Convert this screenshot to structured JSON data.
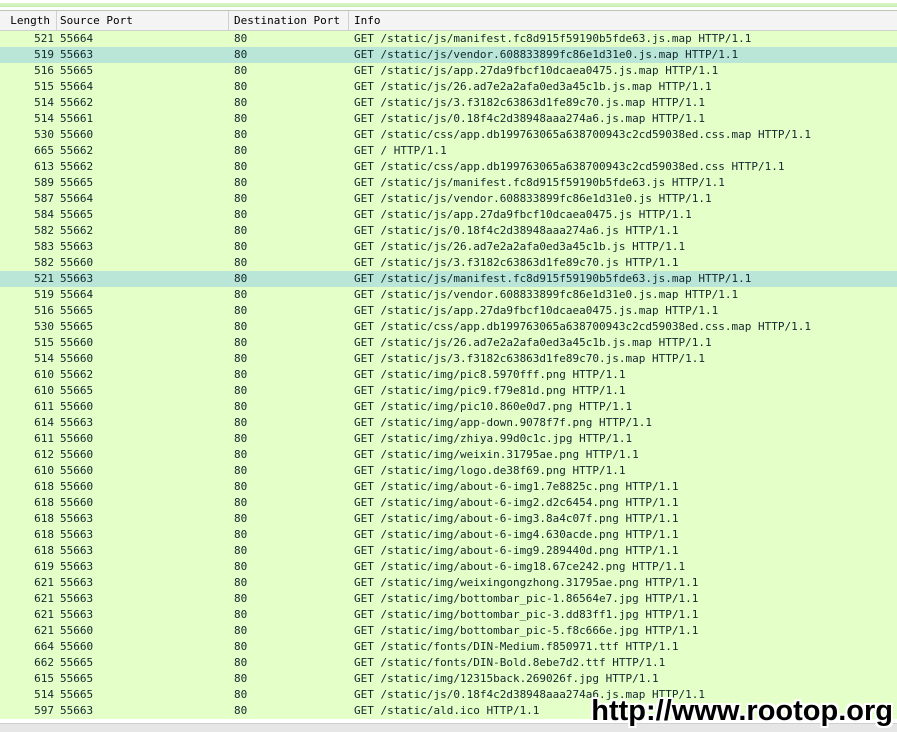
{
  "columns": {
    "length": "Length",
    "source_port": "Source Port",
    "destination_port": "Destination Port",
    "info": "Info"
  },
  "selected_rows": [
    1,
    15
  ],
  "rows": [
    {
      "length": "521",
      "src": "55664",
      "dst": "80",
      "info": "GET /static/js/manifest.fc8d915f59190b5fde63.js.map HTTP/1.1"
    },
    {
      "length": "519",
      "src": "55663",
      "dst": "80",
      "info": "GET /static/js/vendor.608833899fc86e1d31e0.js.map HTTP/1.1"
    },
    {
      "length": "516",
      "src": "55665",
      "dst": "80",
      "info": "GET /static/js/app.27da9fbcf10dcaea0475.js.map HTTP/1.1"
    },
    {
      "length": "515",
      "src": "55664",
      "dst": "80",
      "info": "GET /static/js/26.ad7e2a2afa0ed3a45c1b.js.map HTTP/1.1"
    },
    {
      "length": "514",
      "src": "55662",
      "dst": "80",
      "info": "GET /static/js/3.f3182c63863d1fe89c70.js.map HTTP/1.1"
    },
    {
      "length": "514",
      "src": "55661",
      "dst": "80",
      "info": "GET /static/js/0.18f4c2d38948aaa274a6.js.map HTTP/1.1"
    },
    {
      "length": "530",
      "src": "55660",
      "dst": "80",
      "info": "GET /static/css/app.db199763065a638700943c2cd59038ed.css.map HTTP/1.1"
    },
    {
      "length": "665",
      "src": "55662",
      "dst": "80",
      "info": "GET / HTTP/1.1"
    },
    {
      "length": "613",
      "src": "55662",
      "dst": "80",
      "info": "GET /static/css/app.db199763065a638700943c2cd59038ed.css HTTP/1.1"
    },
    {
      "length": "589",
      "src": "55665",
      "dst": "80",
      "info": "GET /static/js/manifest.fc8d915f59190b5fde63.js HTTP/1.1"
    },
    {
      "length": "587",
      "src": "55664",
      "dst": "80",
      "info": "GET /static/js/vendor.608833899fc86e1d31e0.js HTTP/1.1"
    },
    {
      "length": "584",
      "src": "55665",
      "dst": "80",
      "info": "GET /static/js/app.27da9fbcf10dcaea0475.js HTTP/1.1"
    },
    {
      "length": "582",
      "src": "55662",
      "dst": "80",
      "info": "GET /static/js/0.18f4c2d38948aaa274a6.js HTTP/1.1"
    },
    {
      "length": "583",
      "src": "55663",
      "dst": "80",
      "info": "GET /static/js/26.ad7e2a2afa0ed3a45c1b.js HTTP/1.1"
    },
    {
      "length": "582",
      "src": "55660",
      "dst": "80",
      "info": "GET /static/js/3.f3182c63863d1fe89c70.js HTTP/1.1"
    },
    {
      "length": "521",
      "src": "55663",
      "dst": "80",
      "info": "GET /static/js/manifest.fc8d915f59190b5fde63.js.map HTTP/1.1"
    },
    {
      "length": "519",
      "src": "55664",
      "dst": "80",
      "info": "GET /static/js/vendor.608833899fc86e1d31e0.js.map HTTP/1.1"
    },
    {
      "length": "516",
      "src": "55665",
      "dst": "80",
      "info": "GET /static/js/app.27da9fbcf10dcaea0475.js.map HTTP/1.1"
    },
    {
      "length": "530",
      "src": "55665",
      "dst": "80",
      "info": "GET /static/css/app.db199763065a638700943c2cd59038ed.css.map HTTP/1.1"
    },
    {
      "length": "515",
      "src": "55660",
      "dst": "80",
      "info": "GET /static/js/26.ad7e2a2afa0ed3a45c1b.js.map HTTP/1.1"
    },
    {
      "length": "514",
      "src": "55660",
      "dst": "80",
      "info": "GET /static/js/3.f3182c63863d1fe89c70.js.map HTTP/1.1"
    },
    {
      "length": "610",
      "src": "55662",
      "dst": "80",
      "info": "GET /static/img/pic8.5970fff.png HTTP/1.1"
    },
    {
      "length": "610",
      "src": "55665",
      "dst": "80",
      "info": "GET /static/img/pic9.f79e81d.png HTTP/1.1"
    },
    {
      "length": "611",
      "src": "55660",
      "dst": "80",
      "info": "GET /static/img/pic10.860e0d7.png HTTP/1.1"
    },
    {
      "length": "614",
      "src": "55663",
      "dst": "80",
      "info": "GET /static/img/app-down.9078f7f.png HTTP/1.1"
    },
    {
      "length": "611",
      "src": "55660",
      "dst": "80",
      "info": "GET /static/img/zhiya.99d0c1c.jpg HTTP/1.1"
    },
    {
      "length": "612",
      "src": "55660",
      "dst": "80",
      "info": "GET /static/img/weixin.31795ae.png HTTP/1.1"
    },
    {
      "length": "610",
      "src": "55660",
      "dst": "80",
      "info": "GET /static/img/logo.de38f69.png HTTP/1.1"
    },
    {
      "length": "618",
      "src": "55660",
      "dst": "80",
      "info": "GET /static/img/about-6-img1.7e8825c.png HTTP/1.1"
    },
    {
      "length": "618",
      "src": "55660",
      "dst": "80",
      "info": "GET /static/img/about-6-img2.d2c6454.png HTTP/1.1"
    },
    {
      "length": "618",
      "src": "55663",
      "dst": "80",
      "info": "GET /static/img/about-6-img3.8a4c07f.png HTTP/1.1"
    },
    {
      "length": "618",
      "src": "55663",
      "dst": "80",
      "info": "GET /static/img/about-6-img4.630acde.png HTTP/1.1"
    },
    {
      "length": "618",
      "src": "55663",
      "dst": "80",
      "info": "GET /static/img/about-6-img9.289440d.png HTTP/1.1"
    },
    {
      "length": "619",
      "src": "55663",
      "dst": "80",
      "info": "GET /static/img/about-6-img18.67ce242.png HTTP/1.1"
    },
    {
      "length": "621",
      "src": "55663",
      "dst": "80",
      "info": "GET /static/img/weixingongzhong.31795ae.png HTTP/1.1"
    },
    {
      "length": "621",
      "src": "55663",
      "dst": "80",
      "info": "GET /static/img/bottombar_pic-1.86564e7.jpg HTTP/1.1"
    },
    {
      "length": "621",
      "src": "55663",
      "dst": "80",
      "info": "GET /static/img/bottombar_pic-3.dd83ff1.jpg HTTP/1.1"
    },
    {
      "length": "621",
      "src": "55660",
      "dst": "80",
      "info": "GET /static/img/bottombar_pic-5.f8c666e.jpg HTTP/1.1"
    },
    {
      "length": "664",
      "src": "55660",
      "dst": "80",
      "info": "GET /static/fonts/DIN-Medium.f850971.ttf HTTP/1.1"
    },
    {
      "length": "662",
      "src": "55665",
      "dst": "80",
      "info": "GET /static/fonts/DIN-Bold.8ebe7d2.ttf HTTP/1.1"
    },
    {
      "length": "615",
      "src": "55665",
      "dst": "80",
      "info": "GET /static/img/12315back.269026f.jpg HTTP/1.1"
    },
    {
      "length": "514",
      "src": "55665",
      "dst": "80",
      "info": "GET /static/js/0.18f4c2d38948aaa274a6.js.map HTTP/1.1"
    },
    {
      "length": "597",
      "src": "55663",
      "dst": "80",
      "info": "GET /static/ald.ico HTTP/1.1"
    }
  ],
  "watermark": "http://www.rootop.org",
  "colors": {
    "row_background": "#e4ffc7",
    "selected_row_background": "#b9e6d6",
    "header_background": "#f4f4f4"
  }
}
